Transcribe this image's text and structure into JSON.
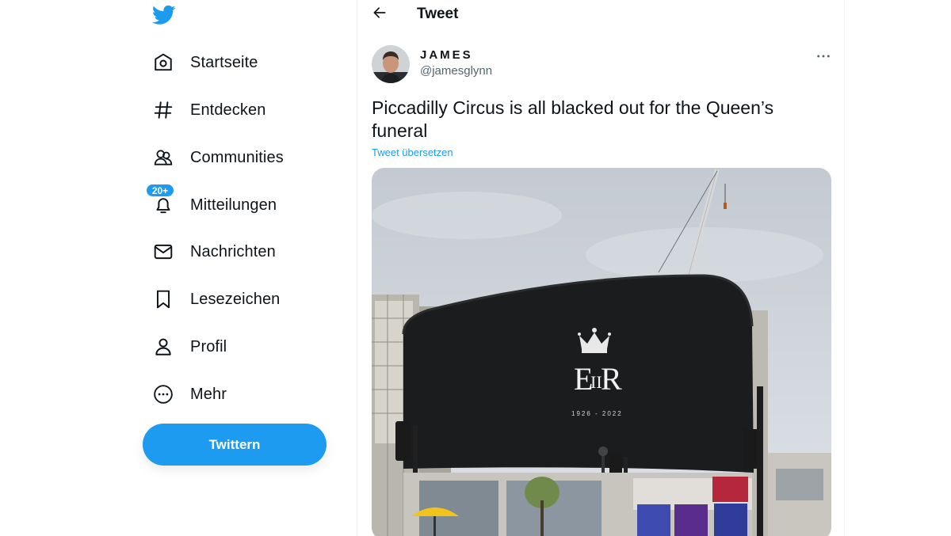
{
  "sidebar": {
    "logo_icon": "twitter-bird-icon",
    "items": [
      {
        "label": "Startseite",
        "icon": "home-icon"
      },
      {
        "label": "Entdecken",
        "icon": "hashtag-icon"
      },
      {
        "label": "Communities",
        "icon": "communities-icon"
      },
      {
        "label": "Mitteilungen",
        "icon": "bell-icon",
        "badge": "20+"
      },
      {
        "label": "Nachrichten",
        "icon": "envelope-icon"
      },
      {
        "label": "Lesezeichen",
        "icon": "bookmark-icon"
      },
      {
        "label": "Profil",
        "icon": "person-icon"
      },
      {
        "label": "Mehr",
        "icon": "more-circle-icon"
      }
    ],
    "tweet_button": "Twittern"
  },
  "header": {
    "title": "Tweet",
    "back_icon": "arrow-left-icon"
  },
  "tweet": {
    "display_name": "JAMES",
    "handle": "@jamesglynn",
    "text": "Piccadilly Circus is all blacked out for the Queen’s funeral",
    "translate_link": "Tweet übersetzen",
    "more_icon": "more-horizontal-icon",
    "media": {
      "screen_years": "1926 - 2022"
    }
  },
  "colors": {
    "accent": "#1d9bf0",
    "text": "#0f1419",
    "secondary_text": "#536471"
  }
}
